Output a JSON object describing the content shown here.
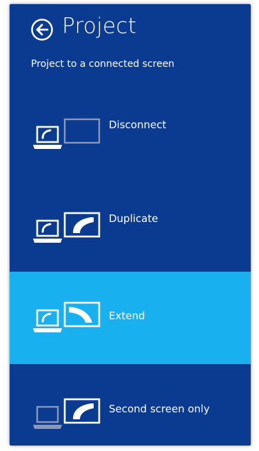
{
  "header": {
    "title": "Project",
    "subtitle": "Project to a connected screen"
  },
  "options": [
    {
      "id": "disconnect",
      "label": "Disconnect",
      "selected": false
    },
    {
      "id": "duplicate",
      "label": "Duplicate",
      "selected": false
    },
    {
      "id": "extend",
      "label": "Extend",
      "selected": true
    },
    {
      "id": "second",
      "label": "Second screen only",
      "selected": false
    }
  ],
  "colors": {
    "pane_background": "#0b3b91",
    "selected_background": "#19b0f0",
    "text": "#ffffff"
  }
}
